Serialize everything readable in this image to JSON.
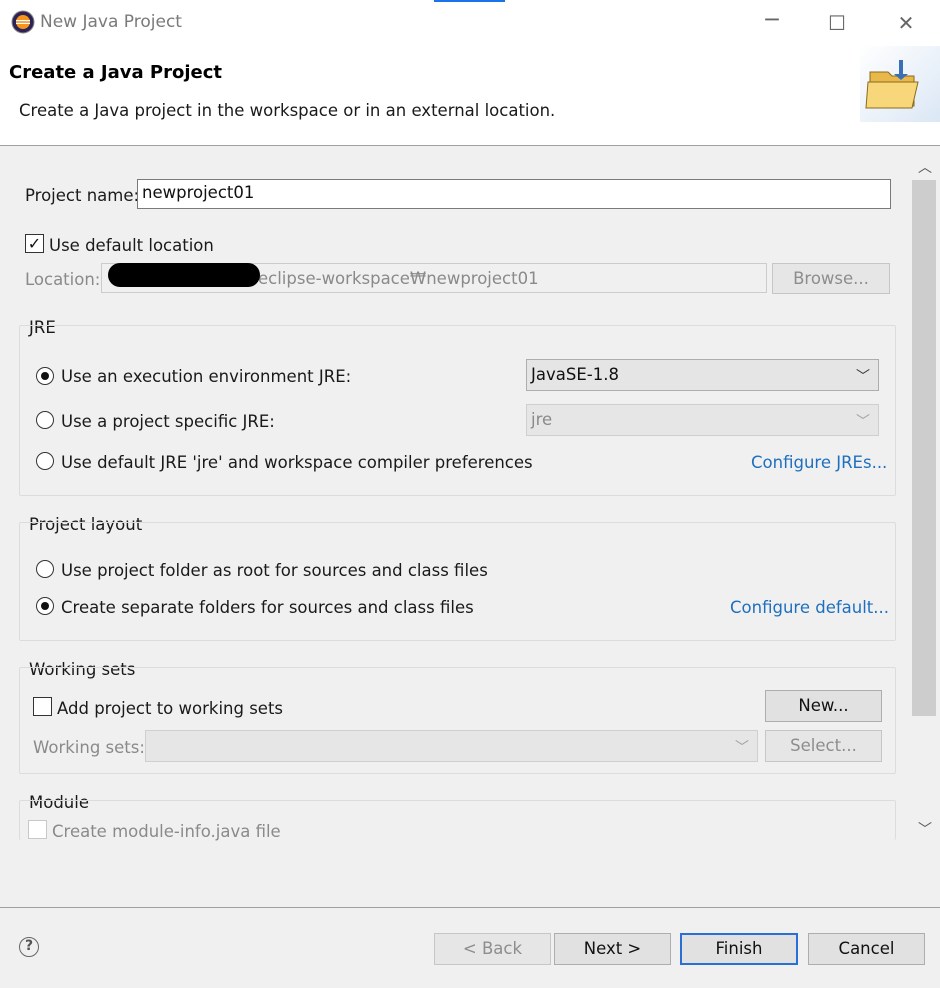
{
  "window": {
    "title": "New Java Project",
    "maximize_glyph": "☐",
    "close_glyph": "✕"
  },
  "header": {
    "title": "Create a Java Project",
    "description": "Create a Java project in the workspace or in an external location."
  },
  "project": {
    "name_label": "Project name:",
    "name_value": "newproject01",
    "use_default_location_label": "Use default location",
    "use_default_location_checked": true,
    "location_label": "Location:",
    "location_value": "eclipse-workspace₩newproject01",
    "browse_label": "Browse..."
  },
  "jre": {
    "group_label": "JRE",
    "option_exec_env": "Use an execution environment JRE:",
    "option_specific": "Use a project specific JRE:",
    "option_default": "Use default JRE 'jre' and workspace compiler preferences",
    "exec_env_value": "JavaSE-1.8",
    "specific_value": "jre",
    "configure_link": "Configure JREs...",
    "selected": "exec_env"
  },
  "layout": {
    "group_label": "Project layout",
    "option_root": "Use project folder as root for sources and class files",
    "option_separate": "Create separate folders for sources and class files",
    "configure_link": "Configure default...",
    "selected": "separate"
  },
  "working_sets": {
    "group_label": "Working sets",
    "add_label": "Add project to working sets",
    "add_checked": false,
    "new_button": "New...",
    "sets_label": "Working sets:",
    "select_button": "Select..."
  },
  "module": {
    "group_label": "Module",
    "create_label": "Create module-info.java file"
  },
  "footer": {
    "help_glyph": "?",
    "back_label": "< Back",
    "next_label": "Next >",
    "finish_label": "Finish",
    "cancel_label": "Cancel"
  },
  "colors": {
    "link": "#1f6fbf",
    "default_button_border": "#2a6fd6",
    "dialog_bg": "#f0f0f0"
  }
}
